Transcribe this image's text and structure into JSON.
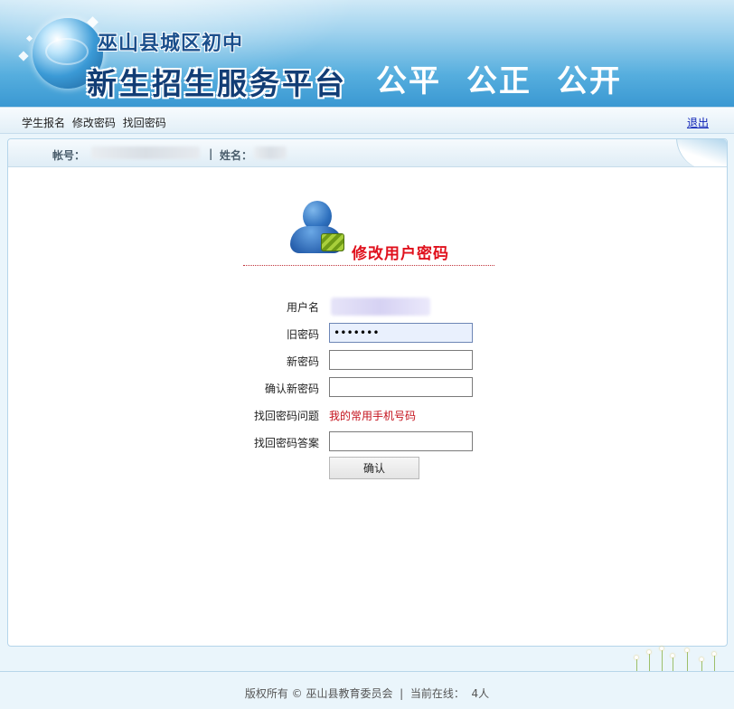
{
  "banner": {
    "school_name": "巫山县城区初中",
    "platform_title": "新生招生服务平台",
    "slogan": [
      "公平",
      "公正",
      "公开"
    ]
  },
  "nav": {
    "links": [
      "学生报名",
      "修改密码",
      "找回密码"
    ],
    "logout": "退出"
  },
  "panel_header": {
    "account_label": "帐号：",
    "separator": "|",
    "name_label": "姓名："
  },
  "form": {
    "title": "修改用户密码",
    "username_label": "用户名",
    "old_password_label": "旧密码",
    "old_password_value": "•••••••",
    "new_password_label": "新密码",
    "confirm_password_label": "确认新密码",
    "question_label": "找回密码问题",
    "question_value": "我的常用手机号码",
    "answer_label": "找回密码答案",
    "submit_label": "确认"
  },
  "footer": {
    "copyright": "版权所有 © 巫山县教育委员会",
    "separator": "|",
    "online_label": "当前在线：",
    "online_count": "4人"
  },
  "colors": {
    "accent_red": "#e0101c",
    "question_red": "#c4121c",
    "logout_blue": "#0b1fb5",
    "banner_blue": "#3a98d2"
  }
}
